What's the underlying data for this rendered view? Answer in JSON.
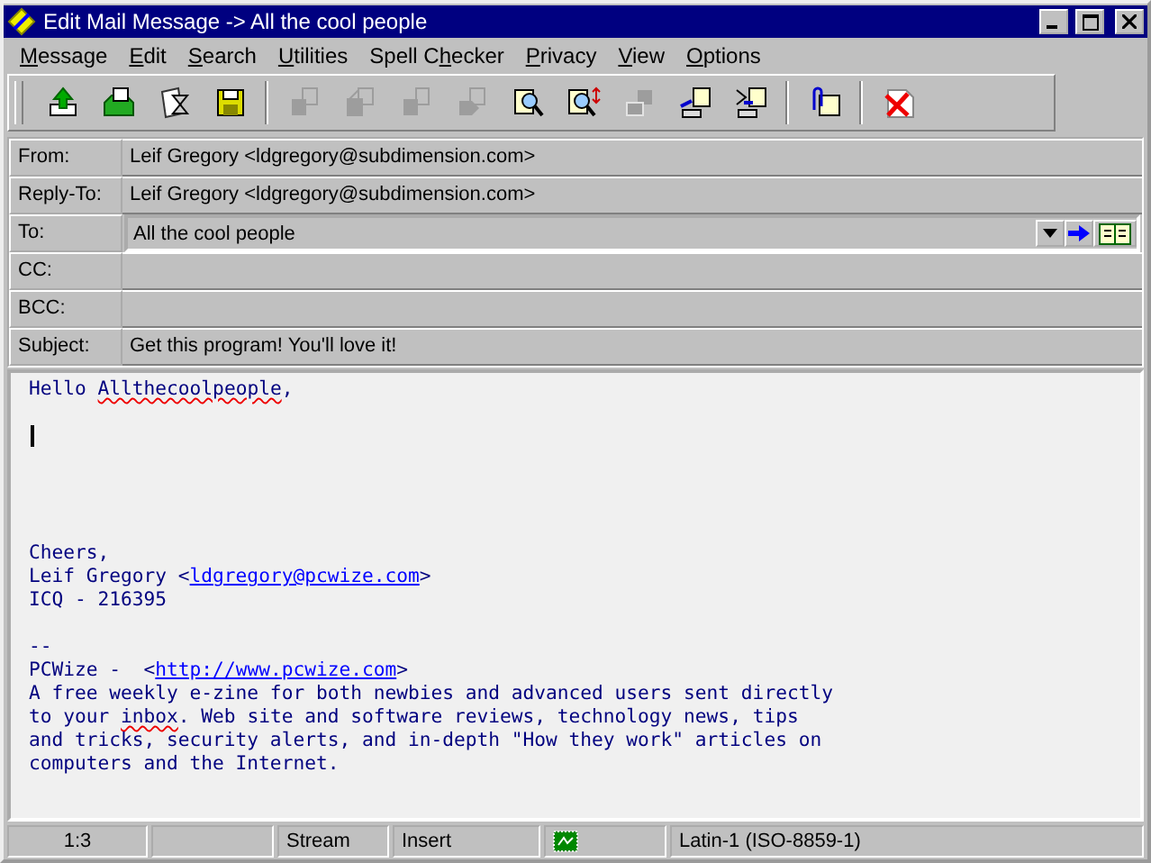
{
  "window": {
    "title": "Edit Mail Message -> All the cool people"
  },
  "menu": [
    {
      "accel": "M",
      "after": "essage"
    },
    {
      "accel": "E",
      "after": "dit"
    },
    {
      "accel": "S",
      "after": "earch"
    },
    {
      "accel": "U",
      "after": "tilities"
    },
    {
      "before": "Spell C",
      "accel": "h",
      "after": "ecker"
    },
    {
      "accel": "P",
      "after": "rivacy"
    },
    {
      "accel": "V",
      "after": "iew"
    },
    {
      "accel": "O",
      "after": "ptions"
    }
  ],
  "toolbar": [
    [
      {
        "disabled": false
      },
      {
        "disabled": false
      },
      {
        "disabled": false
      },
      {
        "disabled": false
      }
    ],
    [
      {
        "disabled": true
      },
      {
        "disabled": true
      },
      {
        "disabled": true
      },
      {
        "disabled": true
      },
      {
        "disabled": false
      },
      {
        "disabled": false
      },
      {
        "disabled": true
      },
      {
        "disabled": false
      },
      {
        "disabled": false
      }
    ],
    [
      {
        "disabled": false
      }
    ],
    [
      {
        "disabled": false
      }
    ]
  ],
  "headers": [
    {
      "label": "From:",
      "value": "Leif Gregory <ldgregory@subdimension.com>",
      "kind": "static"
    },
    {
      "label": "Reply-To:",
      "value": "Leif Gregory <ldgregory@subdimension.com>",
      "kind": "static"
    },
    {
      "label": "To:",
      "value": "All the cool people",
      "kind": "combo"
    },
    {
      "label": "CC:",
      "kind": "static"
    },
    {
      "label": "BCC:",
      "kind": "static"
    },
    {
      "label": "Subject:",
      "value": "Get this program! You'll love it!",
      "kind": "static"
    }
  ],
  "body": {
    "paragraphs": [
      [
        [
          {
            "text": "Hello ",
            "kind": "plain"
          },
          {
            "text": "Allthecoolpeople",
            "kind": "misspelled"
          },
          {
            "text": ",",
            "kind": "plain"
          }
        ]
      ],
      [
        [
          {
            "text": "Cheers,",
            "kind": "plain"
          }
        ],
        [
          {
            "text": "Leif Gregory <",
            "kind": "plain"
          },
          {
            "text": "ldgregory@pcwize.com",
            "kind": "link"
          },
          {
            "text": ">",
            "kind": "plain"
          }
        ],
        [
          {
            "text": "ICQ - 216395",
            "kind": "plain"
          }
        ]
      ],
      [
        [
          {
            "text": "--",
            "kind": "plain"
          }
        ],
        [
          {
            "text": "PCWize -  <",
            "kind": "plain"
          },
          {
            "text": "http://www.pcwize.com",
            "kind": "link"
          },
          {
            "text": ">",
            "kind": "plain"
          }
        ],
        [
          {
            "text": "A free weekly e-zine for both newbies and advanced users sent directly",
            "kind": "plain"
          }
        ],
        [
          {
            "text": "to your ",
            "kind": "plain"
          },
          {
            "text": "inbox",
            "kind": "misspelled"
          },
          {
            "text": ". Web site and software reviews, technology news, tips",
            "kind": "plain"
          }
        ],
        [
          {
            "text": "and tricks, security alerts, and in-depth \"How they work\" articles on",
            "kind": "plain"
          }
        ],
        [
          {
            "text": "computers and the Internet.",
            "kind": "plain"
          }
        ]
      ]
    ]
  },
  "status_bar": [
    {
      "kind": "text",
      "text": "1:3"
    },
    {
      "kind": "blank"
    },
    {
      "kind": "text",
      "text": "Stream"
    },
    {
      "kind": "text",
      "text": "Insert"
    },
    {
      "kind": "icon"
    },
    {
      "kind": "text",
      "text": "Latin-1 (ISO-8859-1)"
    }
  ]
}
